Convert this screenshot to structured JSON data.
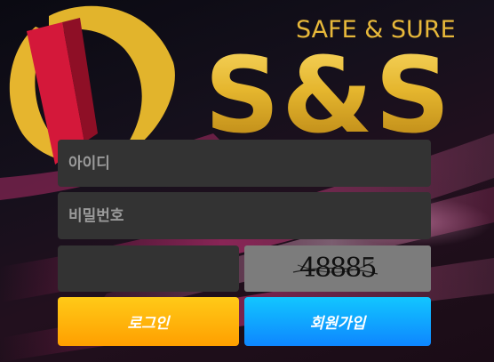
{
  "brand": {
    "tagline": "SAFE & SURE",
    "name": "S&S"
  },
  "login_form": {
    "id_placeholder": "아이디",
    "password_placeholder": "비밀번호",
    "captcha_input_value": "",
    "captcha_code": "48885",
    "login_label": "로그인",
    "signup_label": "회원가입"
  },
  "colors": {
    "gold": "#e7b83a",
    "logo_red": "#d91a3a",
    "field_bg": "#333333",
    "login_button": "#ffb000",
    "signup_button": "#0ea8ff"
  }
}
